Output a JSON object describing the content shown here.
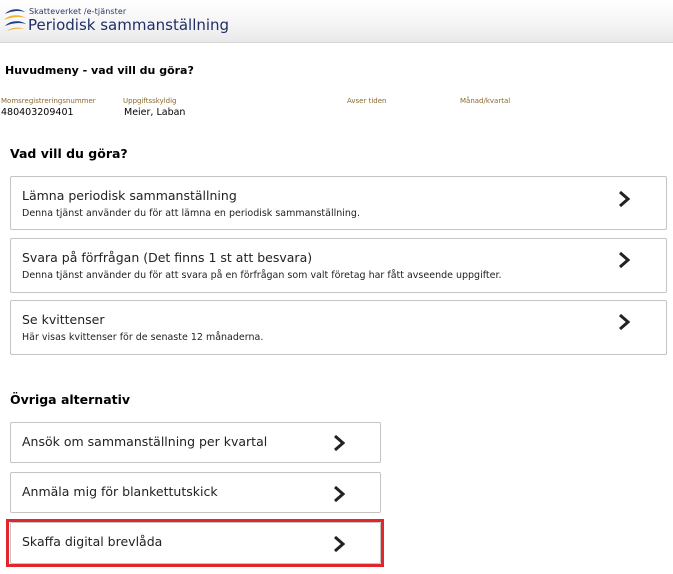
{
  "header": {
    "agency": "Skatteverket /e-tjänster",
    "title": "Periodisk sammanställning",
    "logo_icon": "skatteverket-logo-icon"
  },
  "page": {
    "menu_title": "Huvudmeny - vad vill du göra?"
  },
  "info": {
    "vat_label": "Momsregistreringsnummer",
    "vat_value": "480403209401",
    "taxpayer_label": "Uppgiftsskyldig",
    "taxpayer_value": "Meier, Laban",
    "period_label": "Avser tiden",
    "month_label": "Månad/kvartal"
  },
  "main_section": {
    "heading": "Vad vill du göra?",
    "options": [
      {
        "title": "Lämna periodisk sammanställning",
        "description": "Denna tjänst använder du för att lämna en periodisk sammanställning."
      },
      {
        "title": "Svara på förfrågan (Det finns 1 st att besvara)",
        "description": "Denna tjänst använder du för att svara på en förfrågan som valt företag har fått avseende uppgifter."
      },
      {
        "title": "Se kvittenser",
        "description": "Här visas kvittenser för de senaste 12 månaderna."
      }
    ]
  },
  "other_section": {
    "heading": "Övriga alternativ",
    "options": [
      {
        "title": "Ansök om sammanställning per kvartal"
      },
      {
        "title": "Anmäla mig för blankettutskick"
      },
      {
        "title": "Skaffa digital brevlåda"
      }
    ]
  },
  "colors": {
    "highlight": "#e3262e",
    "title_blue": "#1f2f66",
    "label_brown": "#8a6a2f"
  },
  "icons": {
    "chevron": "chevron-right-icon"
  }
}
